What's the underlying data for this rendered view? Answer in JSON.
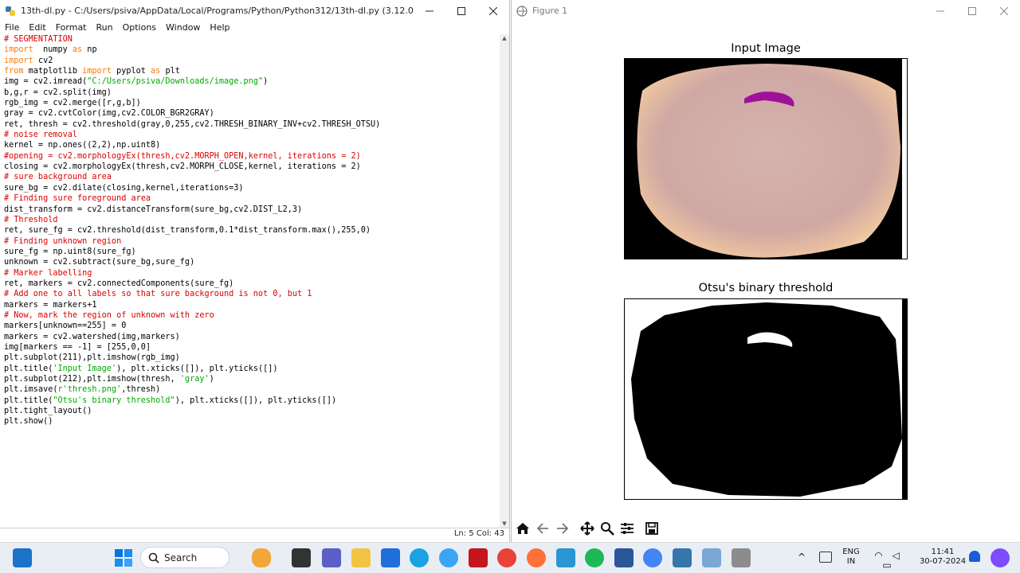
{
  "editor": {
    "title": "13th-dl.py - C:/Users/psiva/AppData/Local/Programs/Python/Python312/13th-dl.py (3.12.0)",
    "menu": [
      "File",
      "Edit",
      "Format",
      "Run",
      "Options",
      "Window",
      "Help"
    ],
    "status": "Ln: 5   Col: 43",
    "code": [
      [
        [
          "cm",
          "# SEGMENTATION"
        ]
      ],
      [
        [
          "kw",
          "import"
        ],
        [
          "",
          "  numpy "
        ],
        [
          "kw",
          "as"
        ],
        [
          "",
          " np"
        ]
      ],
      [
        [
          "kw",
          "import"
        ],
        [
          "",
          " cv2"
        ]
      ],
      [
        [
          "kw",
          "from"
        ],
        [
          "",
          " matplotlib "
        ],
        [
          "kw",
          "import"
        ],
        [
          "",
          " pyplot "
        ],
        [
          "kw",
          "as"
        ],
        [
          "",
          " plt"
        ]
      ],
      [
        [
          "",
          "img = cv2.imread("
        ],
        [
          "str",
          "\"C:/Users/psiva/Downloads/image.png\""
        ],
        [
          "",
          ")"
        ]
      ],
      [
        [
          "",
          "b,g,r = cv2.split(img)"
        ]
      ],
      [
        [
          "",
          "rgb_img = cv2.merge([r,g,b])"
        ]
      ],
      [
        [
          "",
          "gray = cv2.cvtColor(img,cv2.COLOR_BGR2GRAY)"
        ]
      ],
      [
        [
          "",
          "ret, thresh = cv2.threshold(gray,0,255,cv2.THRESH_BINARY_INV+cv2.THRESH_OTSU)"
        ]
      ],
      [
        [
          "cm",
          "# noise removal"
        ]
      ],
      [
        [
          "",
          "kernel = np.ones((2,2),np.uint8)"
        ]
      ],
      [
        [
          "cm",
          "#opening = cv2.morphologyEx(thresh,cv2.MORPH_OPEN,kernel, iterations = 2)"
        ]
      ],
      [
        [
          "",
          "closing = cv2.morphologyEx(thresh,cv2.MORPH_CLOSE,kernel, iterations = 2)"
        ]
      ],
      [
        [
          "cm",
          "# sure background area"
        ]
      ],
      [
        [
          "",
          "sure_bg = cv2.dilate(closing,kernel,iterations=3)"
        ]
      ],
      [
        [
          "cm",
          "# Finding sure foreground area"
        ]
      ],
      [
        [
          "",
          "dist_transform = cv2.distanceTransform(sure_bg,cv2.DIST_L2,3)"
        ]
      ],
      [
        [
          "cm",
          "# Threshold"
        ]
      ],
      [
        [
          "",
          "ret, sure_fg = cv2.threshold(dist_transform,0.1*dist_transform.max(),255,0)"
        ]
      ],
      [
        [
          "cm",
          "# Finding unknown region"
        ]
      ],
      [
        [
          "",
          "sure_fg = np.uint8(sure_fg)"
        ]
      ],
      [
        [
          "",
          "unknown = cv2.subtract(sure_bg,sure_fg)"
        ]
      ],
      [
        [
          "cm",
          "# Marker labelling"
        ]
      ],
      [
        [
          "",
          "ret, markers = cv2.connectedComponents(sure_fg)"
        ]
      ],
      [
        [
          "cm",
          "# Add one to all labels so that sure background is not 0, but 1"
        ]
      ],
      [
        [
          "",
          "markers = markers+1"
        ]
      ],
      [
        [
          "cm",
          "# Now, mark the region of unknown with zero"
        ]
      ],
      [
        [
          "",
          "markers[unknown==255] = 0"
        ]
      ],
      [
        [
          "",
          "markers = cv2.watershed(img,markers)"
        ]
      ],
      [
        [
          "",
          "img[markers == -1] = [255,0,0]"
        ]
      ],
      [
        [
          "",
          "plt.subplot(211),plt.imshow(rgb_img)"
        ]
      ],
      [
        [
          "",
          "plt.title("
        ],
        [
          "str",
          "'Input Image'"
        ],
        [
          "",
          "), plt.xticks([]), plt.yticks([])"
        ]
      ],
      [
        [
          "",
          "plt.subplot(212),plt.imshow(thresh, "
        ],
        [
          "str",
          "'gray'"
        ],
        [
          "",
          ")"
        ]
      ],
      [
        [
          "",
          "plt.imsave("
        ],
        [
          "str",
          "r'thresh.png'"
        ],
        [
          "",
          ",thresh)"
        ]
      ],
      [
        [
          "",
          "plt.title("
        ],
        [
          "str",
          "\"Otsu's binary threshold\""
        ],
        [
          "",
          "), plt.xticks([]), plt.yticks([])"
        ]
      ],
      [
        [
          "",
          "plt.tight_layout()"
        ]
      ],
      [
        [
          "",
          "plt.show()"
        ]
      ]
    ]
  },
  "figure": {
    "title": "Figure 1",
    "subplot1_title": "Input Image",
    "subplot2_title": "Otsu's binary threshold"
  },
  "taskbar": {
    "search_placeholder": "Search",
    "lang_line1": "ENG",
    "lang_line2": "IN",
    "time": "11:41",
    "date": "30-07-2024"
  }
}
